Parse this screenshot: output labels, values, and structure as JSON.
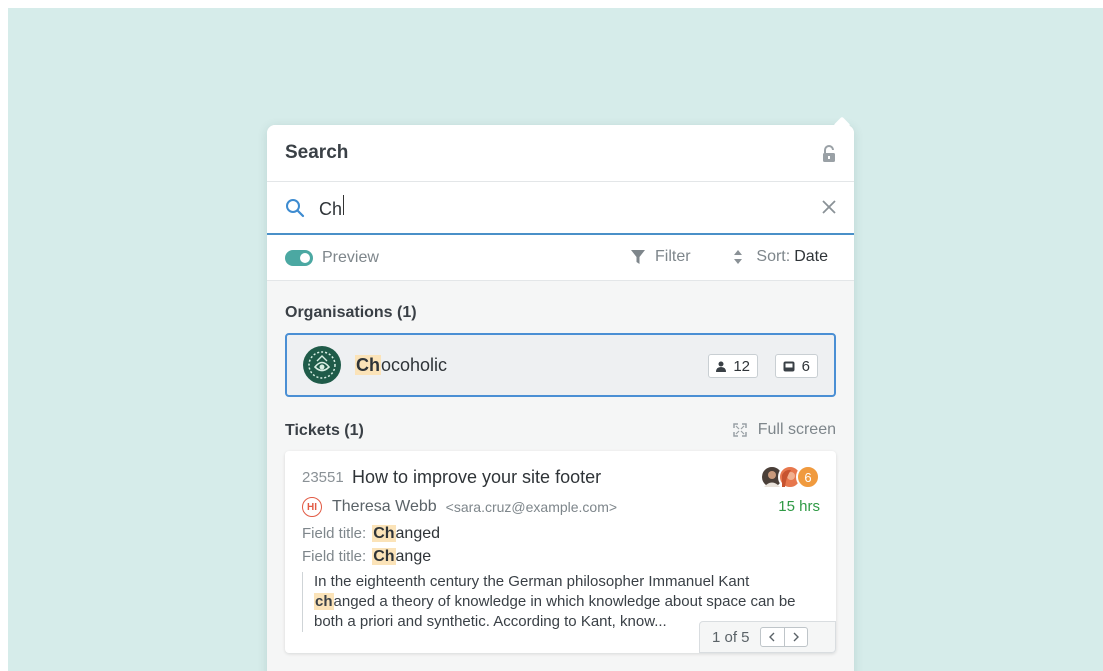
{
  "panel": {
    "title": "Search"
  },
  "search": {
    "value": "Ch"
  },
  "toolbar": {
    "preview_label": "Preview",
    "preview_on": true,
    "filter_label": "Filter",
    "sort_label": "Sort:",
    "sort_value": "Date"
  },
  "organisations": {
    "heading": "Organisations (1)",
    "items": [
      {
        "name_match": "Ch",
        "name_rest": "ocoholic",
        "people_count": "12",
        "tickets_count": "6"
      }
    ]
  },
  "tickets": {
    "heading": "Tickets (1)",
    "full_screen_label": "Full screen",
    "items": [
      {
        "id": "23551",
        "title": "How to improve your site footer",
        "extra_agents": "6",
        "age": "15 hrs",
        "requester_initials": "HI",
        "requester_name": "Theresa Webb",
        "requester_email": "<sara.cruz@example.com>",
        "fields": [
          {
            "label": "Field title:",
            "match": "Ch",
            "rest": "anged"
          },
          {
            "label": "Field title:",
            "match": "Ch",
            "rest": "ange"
          }
        ],
        "excerpt_line1": "In the eighteenth century the German philosopher Immanuel Kant",
        "excerpt_match": "ch",
        "excerpt_line2_rest": "anged a theory of knowledge in which knowledge about space can be",
        "excerpt_line3": "both a priori and synthetic. According to Kant, know...",
        "pager": "1 of 5"
      }
    ]
  },
  "colors": {
    "background": "#d6ecea",
    "accent": "#4a90c8",
    "toggle": "#4ba8a2",
    "highlight": "#fbe3b8",
    "age_green": "#2f9a45"
  }
}
